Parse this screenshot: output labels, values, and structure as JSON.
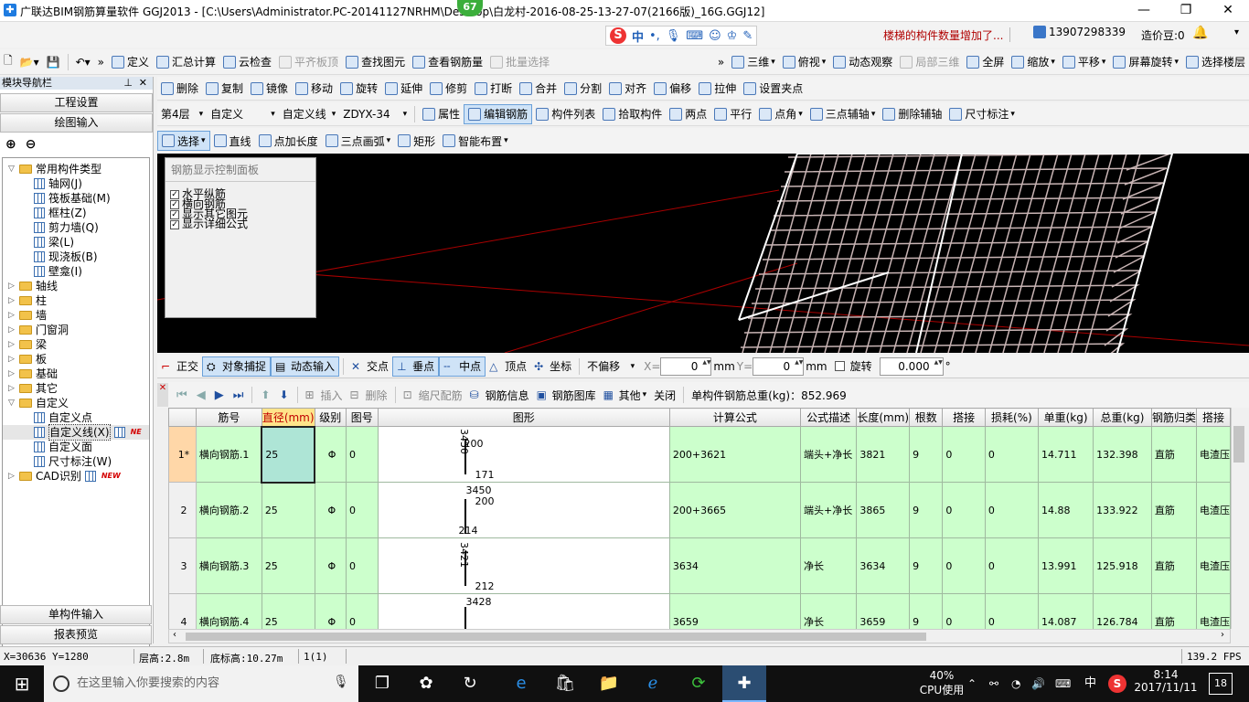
{
  "titlebar": {
    "title": "广联达BIM钢筋算量软件 GGJ2013 - [C:\\Users\\Administrator.PC-20141127NRHM\\Desktop\\白龙村-2016-08-25-13-27-07(2166版)_16G.GGJ12]",
    "badge": "67",
    "minimize": "—",
    "restore": "❐",
    "close": "✕"
  },
  "notify_bar": {
    "message": "楼梯的构件数量增加了...",
    "phone": "13907298339",
    "price_bean": "造价豆:0"
  },
  "ime": {
    "logo": "S",
    "lang": "中",
    "punct": "•,"
  },
  "menubar": [
    {
      "label": "定义",
      "icon": "define-icon"
    },
    {
      "label": "汇总计算",
      "icon": "sigma-icon"
    },
    {
      "label": "云检查",
      "icon": "cloud-check-icon"
    },
    {
      "label": "平齐板顶",
      "icon": "align-top-icon",
      "dim": true
    },
    {
      "label": "查找图元",
      "icon": "binoculars-icon"
    },
    {
      "label": "查看钢筋量",
      "icon": "view-rebar-icon"
    },
    {
      "label": "批量选择",
      "icon": "batch-select-icon",
      "dim": true
    }
  ],
  "menubar_right": [
    {
      "label": "三维",
      "icon": "cube-icon",
      "chev": true
    },
    {
      "label": "俯视",
      "icon": "top-view-icon",
      "chev": true
    },
    {
      "label": "动态观察",
      "icon": "orbit-icon"
    },
    {
      "label": "局部三维",
      "icon": "local-3d-icon",
      "dim": true
    },
    {
      "label": "全屏",
      "icon": "fullscreen-icon"
    },
    {
      "label": "缩放",
      "icon": "zoom-icon",
      "chev": true
    },
    {
      "label": "平移",
      "icon": "pan-icon",
      "chev": true
    },
    {
      "label": "屏幕旋转",
      "icon": "rotate-screen-icon",
      "chev": true
    },
    {
      "label": "选择楼层",
      "icon": "floor-select-icon"
    }
  ],
  "edit_toolbar": [
    {
      "label": "删除",
      "icon": "delete-icon"
    },
    {
      "label": "复制",
      "icon": "copy-icon"
    },
    {
      "label": "镜像",
      "icon": "mirror-icon"
    },
    {
      "label": "移动",
      "icon": "move-icon"
    },
    {
      "label": "旋转",
      "icon": "rotate-icon"
    },
    {
      "label": "延伸",
      "icon": "extend-icon"
    },
    {
      "label": "修剪",
      "icon": "trim-icon"
    },
    {
      "label": "打断",
      "icon": "break-icon"
    },
    {
      "label": "合并",
      "icon": "merge-icon"
    },
    {
      "label": "分割",
      "icon": "split-icon"
    },
    {
      "label": "对齐",
      "icon": "align-icon"
    },
    {
      "label": "偏移",
      "icon": "offset-icon"
    },
    {
      "label": "拉伸",
      "icon": "stretch-icon"
    },
    {
      "label": "设置夹点",
      "icon": "grip-icon"
    }
  ],
  "layer_toolbar": {
    "floor": "第4层",
    "category": "自定义",
    "type": "自定义线",
    "name": "ZDYX-34",
    "buttons": [
      {
        "label": "属性",
        "icon": "property-icon"
      },
      {
        "label": "编辑钢筋",
        "icon": "edit-rebar-icon",
        "active": true
      },
      {
        "label": "构件列表",
        "icon": "list-icon"
      },
      {
        "label": "拾取构件",
        "icon": "pick-icon"
      },
      {
        "label": "两点",
        "icon": "two-point-icon"
      },
      {
        "label": "平行",
        "icon": "parallel-icon"
      },
      {
        "label": "点角",
        "icon": "point-angle-icon",
        "chev": true
      },
      {
        "label": "三点辅轴",
        "icon": "three-point-axis-icon",
        "chev": true
      },
      {
        "label": "删除辅轴",
        "icon": "delete-axis-icon"
      },
      {
        "label": "尺寸标注",
        "icon": "dimension-icon",
        "chev": true
      }
    ]
  },
  "draw_toolbar": [
    {
      "label": "选择",
      "icon": "cursor-icon",
      "active": true,
      "chev": true
    },
    {
      "label": "直线",
      "icon": "line-icon"
    },
    {
      "label": "点加长度",
      "icon": "point-length-icon"
    },
    {
      "label": "三点画弧",
      "icon": "arc-icon",
      "chev": true
    },
    {
      "label": "矩形",
      "icon": "rect-icon"
    },
    {
      "label": "智能布置",
      "icon": "smart-layout-icon",
      "chev": true
    }
  ],
  "leftnav": {
    "header": "模块导航栏",
    "pin": "⊥",
    "close": "✕",
    "btn_project": "工程设置",
    "btn_draw": "绘图输入",
    "btn_single": "单构件输入",
    "btn_report": "报表预览",
    "tree": [
      {
        "label": "常用构件类型",
        "level": 0,
        "expand": "⊟",
        "kind": "folder"
      },
      {
        "label": "轴网(J)",
        "level": 1,
        "kind": "item"
      },
      {
        "label": "筏板基础(M)",
        "level": 1,
        "kind": "item"
      },
      {
        "label": "框柱(Z)",
        "level": 1,
        "kind": "item"
      },
      {
        "label": "剪力墙(Q)",
        "level": 1,
        "kind": "item"
      },
      {
        "label": "梁(L)",
        "level": 1,
        "kind": "item"
      },
      {
        "label": "现浇板(B)",
        "level": 1,
        "kind": "item"
      },
      {
        "label": "壁龛(I)",
        "level": 1,
        "kind": "item"
      },
      {
        "label": "轴线",
        "level": 0,
        "expand": "⊞",
        "kind": "folder"
      },
      {
        "label": "柱",
        "level": 0,
        "expand": "⊞",
        "kind": "folder"
      },
      {
        "label": "墙",
        "level": 0,
        "expand": "⊞",
        "kind": "folder"
      },
      {
        "label": "门窗洞",
        "level": 0,
        "expand": "⊞",
        "kind": "folder"
      },
      {
        "label": "梁",
        "level": 0,
        "expand": "⊞",
        "kind": "folder"
      },
      {
        "label": "板",
        "level": 0,
        "expand": "⊞",
        "kind": "folder"
      },
      {
        "label": "基础",
        "level": 0,
        "expand": "⊞",
        "kind": "folder"
      },
      {
        "label": "其它",
        "level": 0,
        "expand": "⊞",
        "kind": "folder"
      },
      {
        "label": "自定义",
        "level": 0,
        "expand": "⊟",
        "kind": "folder"
      },
      {
        "label": "自定义点",
        "level": 1,
        "kind": "item"
      },
      {
        "label": "自定义线(X)",
        "level": 1,
        "kind": "item",
        "selected": true,
        "new": "NE"
      },
      {
        "label": "自定义面",
        "level": 1,
        "kind": "item"
      },
      {
        "label": "尺寸标注(W)",
        "level": 1,
        "kind": "item"
      },
      {
        "label": "CAD识别",
        "level": 0,
        "expand": "⊞",
        "kind": "folder",
        "new": "NEW"
      }
    ]
  },
  "control_panel": {
    "title": "钢筋显示控制面板",
    "checks": [
      "水平纵筋",
      "横向钢筋",
      "显示其它图元",
      "显示详细公式"
    ]
  },
  "snapbar": {
    "ortho": "正交",
    "snap": "对象捕捉",
    "dyninput": "动态输入",
    "intersect": "交点",
    "perp": "垂点",
    "mid": "中点",
    "vertex": "顶点",
    "coord": "坐标",
    "offset_mode": "不偏移",
    "x_label": "X=",
    "x_value": "0",
    "y_label": "Y=",
    "y_value": "0",
    "unit": "mm",
    "rotate_label": "旋转",
    "rotate_value": "0.000",
    "deg": "°"
  },
  "table_toolbar": {
    "insert": "插入",
    "delete": "删除",
    "scale": "缩尺配筋",
    "info": "钢筋信息",
    "library": "钢筋图库",
    "other": "其他",
    "close": "关闭",
    "total": "单构件钢筋总重(kg)：852.969"
  },
  "table": {
    "headers": [
      "筋号",
      "直径(mm)",
      "级别",
      "图号",
      "图形",
      "计算公式",
      "公式描述",
      "长度(mm)",
      "根数",
      "搭接",
      "损耗(%)",
      "单重(kg)",
      "总重(kg)",
      "钢筋归类",
      "搭接"
    ],
    "rows": [
      {
        "rn": "1*",
        "name": "横向钢筋.1",
        "dia": "25",
        "grade": "Φ",
        "fig": "0",
        "shape_top": "3450",
        "shape_mid": "200",
        "shape_bot": "171",
        "formula": "200+3621",
        "desc": "端头+净长",
        "len": "3821",
        "count": "9",
        "lap": "0",
        "loss": "0",
        "unit_wt": "14.711",
        "total_wt": "132.398",
        "class": "直筋",
        "lap_type": "电渣压"
      },
      {
        "rn": "2",
        "name": "横向钢筋.2",
        "dia": "25",
        "grade": "Φ",
        "fig": "0",
        "shape_top": "3450",
        "shape_mid": "200",
        "shape_bot": "214",
        "formula": "200+3665",
        "desc": "端头+净长",
        "len": "3865",
        "count": "9",
        "lap": "0",
        "loss": "0",
        "unit_wt": "14.88",
        "total_wt": "133.922",
        "class": "直筋",
        "lap_type": "电渣压"
      },
      {
        "rn": "3",
        "name": "横向钢筋.3",
        "dia": "25",
        "grade": "Φ",
        "fig": "0",
        "shape_top": "3421",
        "shape_mid": "",
        "shape_bot": "212",
        "formula": "3634",
        "desc": "净长",
        "len": "3634",
        "count": "9",
        "lap": "0",
        "loss": "0",
        "unit_wt": "13.991",
        "total_wt": "125.918",
        "class": "直筋",
        "lap_type": "电渣压"
      },
      {
        "rn": "4",
        "name": "横向钢筋.4",
        "dia": "25",
        "grade": "Φ",
        "fig": "0",
        "shape_top": "3428",
        "shape_mid": "",
        "shape_bot": "",
        "formula": "3659",
        "desc": "净长",
        "len": "3659",
        "count": "9",
        "lap": "0",
        "loss": "0",
        "unit_wt": "14.087",
        "total_wt": "126.784",
        "class": "直筋",
        "lap_type": "电渣压"
      }
    ]
  },
  "status": {
    "coords": "X=30636 Y=1280",
    "floor_height": "层高:2.8m",
    "base_height": "底标高:10.27m",
    "count": "1(1)",
    "fps": "139.2 FPS"
  },
  "taskbar": {
    "search_placeholder": "在这里输入你要搜索的内容",
    "cpu": "40%",
    "cpu_label": "CPU使用",
    "ime": "中",
    "time": "8:14",
    "date": "2017/11/11",
    "notif_count": "18"
  }
}
